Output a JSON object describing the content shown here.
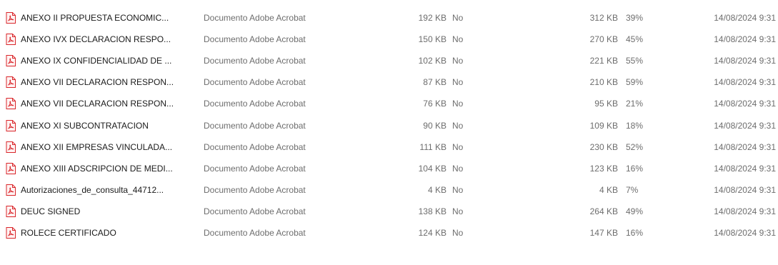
{
  "file_type": "Documento Adobe Acrobat",
  "icon": "pdf-file-icon",
  "colors": {
    "pdf_icon": "#d9252a",
    "name_text": "#1a1a1a",
    "detail_text": "#6d6d6d"
  },
  "files": [
    {
      "name": "ANEXO II PROPUESTA ECONOMIC...",
      "size": "192 KB",
      "protected": "No",
      "original": "312 KB",
      "ratio": "39%",
      "date": "14/08/2024 9:31"
    },
    {
      "name": "ANEXO IVX DECLARACION RESPO...",
      "size": "150 KB",
      "protected": "No",
      "original": "270 KB",
      "ratio": "45%",
      "date": "14/08/2024 9:31"
    },
    {
      "name": "ANEXO IX CONFIDENCIALIDAD DE ...",
      "size": "102 KB",
      "protected": "No",
      "original": "221 KB",
      "ratio": "55%",
      "date": "14/08/2024 9:31"
    },
    {
      "name": "ANEXO VII DECLARACION RESPON...",
      "size": "87 KB",
      "protected": "No",
      "original": "210 KB",
      "ratio": "59%",
      "date": "14/08/2024 9:31"
    },
    {
      "name": "ANEXO VII DECLARACION RESPON...",
      "size": "76 KB",
      "protected": "No",
      "original": "95 KB",
      "ratio": "21%",
      "date": "14/08/2024 9:31"
    },
    {
      "name": "ANEXO XI SUBCONTRATACION",
      "size": "90 KB",
      "protected": "No",
      "original": "109 KB",
      "ratio": "18%",
      "date": "14/08/2024 9:31"
    },
    {
      "name": "ANEXO XII EMPRESAS VINCULADA...",
      "size": "111 KB",
      "protected": "No",
      "original": "230 KB",
      "ratio": "52%",
      "date": "14/08/2024 9:31"
    },
    {
      "name": "ANEXO XIII ADSCRIPCION DE MEDI...",
      "size": "104 KB",
      "protected": "No",
      "original": "123 KB",
      "ratio": "16%",
      "date": "14/08/2024 9:31"
    },
    {
      "name": "Autorizaciones_de_consulta_44712...",
      "size": "4 KB",
      "protected": "No",
      "original": "4 KB",
      "ratio": "7%",
      "date": "14/08/2024 9:31"
    },
    {
      "name": "DEUC SIGNED",
      "size": "138 KB",
      "protected": "No",
      "original": "264 KB",
      "ratio": "49%",
      "date": "14/08/2024 9:31"
    },
    {
      "name": "ROLECE CERTIFICADO",
      "size": "124 KB",
      "protected": "No",
      "original": "147 KB",
      "ratio": "16%",
      "date": "14/08/2024 9:31"
    }
  ]
}
